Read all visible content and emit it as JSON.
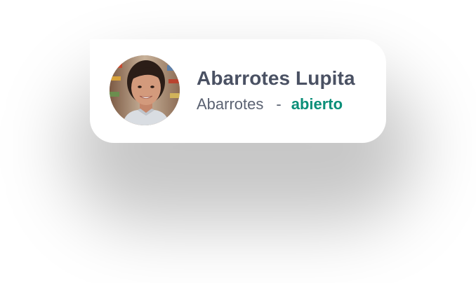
{
  "card": {
    "name": "Abarrotes Lupita",
    "category": "Abarrotes",
    "separator": "-",
    "status": "abierto",
    "status_color": "#0b8f79"
  },
  "avatar": {
    "icon": "person-portrait"
  }
}
